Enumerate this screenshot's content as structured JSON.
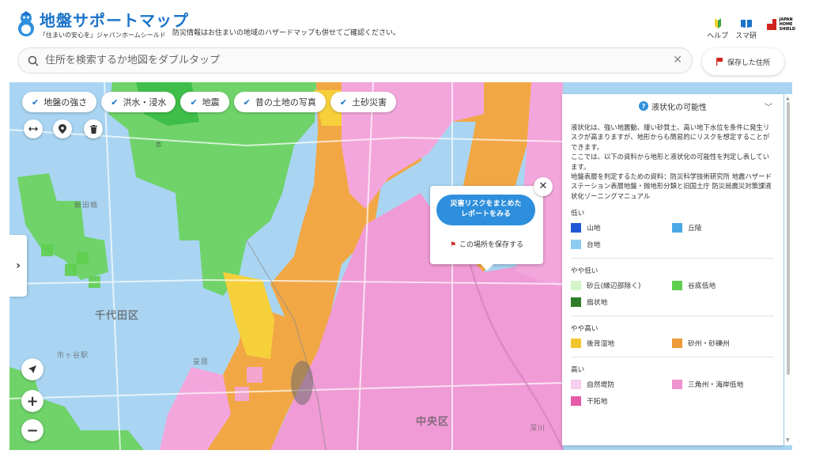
{
  "header": {
    "app_title": "地盤サポートマップ",
    "subtitle": "「住まいの安心を」ジャパンホームシールド",
    "tagline": "防災情報はお住まいの地域のハザードマップも併せてご確認ください。",
    "help_label": "ヘルプ",
    "app_label": "スマ研",
    "brand_logo_text": "JAPAN HOME SHIELD"
  },
  "search": {
    "placeholder": "住所を検索するか地図をダブルタップ",
    "clear_icon": "close-icon"
  },
  "saved_button": {
    "label": "保存した住所"
  },
  "layer_chips": [
    {
      "label": "地盤の強さ",
      "checked": true
    },
    {
      "label": "洪水・浸水",
      "checked": true
    },
    {
      "label": "地震",
      "checked": true
    },
    {
      "label": "昔の土地の写真",
      "checked": true
    },
    {
      "label": "土砂災害",
      "checked": true
    }
  ],
  "map_labels": {
    "chiyoda": "千代田区",
    "chuo": "中央区",
    "hon": "本",
    "kokyo": "皇居",
    "iidabashi": "飯田橋",
    "ichigaya": "市ヶ谷駅",
    "fukagawa": "深川"
  },
  "popup": {
    "report_button": "災害リスクをまとめた\nレポートをみる",
    "save_label": "この場所を保存する"
  },
  "legend": {
    "title": "液状化の可能性",
    "description": "液状化は、強い地震動、緩い砂質土、高い地下水位を条件に発生リスクが高まりますが、地形からも簡易的にリスクを想定することができます。\nここでは、以下の資料から地形と液状化の可能性を判定し表しています。\n地盤表層を判定するための資料：防災科学技術研究所 地震ハザードステーション表層地盤・微地形分類と旧国土庁 防災局震災対策課液状化ゾーニングマニュアル",
    "groups": [
      {
        "title": "低い",
        "items": [
          {
            "label": "山地",
            "color": "#1f57d6"
          },
          {
            "label": "丘陵",
            "color": "#48a9e6"
          },
          {
            "label": "台地",
            "color": "#8ccbf2"
          }
        ]
      },
      {
        "title": "やや低い",
        "items": [
          {
            "label": "砂丘(縁辺部除く)",
            "color": "#d3f5c9"
          },
          {
            "label": "谷底低地",
            "color": "#5fcf4f"
          },
          {
            "label": "扇状地",
            "color": "#2e7d2a"
          }
        ]
      },
      {
        "title": "やや高い",
        "items": [
          {
            "label": "後背湿地",
            "color": "#f2c62f"
          },
          {
            "label": "砂州・砂礫州",
            "color": "#ef9a3a"
          }
        ]
      },
      {
        "title": "高い",
        "items": [
          {
            "label": "自然堤防",
            "color": "#f7cdf0"
          },
          {
            "label": "三角州・海岸低地",
            "color": "#ef93d0"
          },
          {
            "label": "干拓地",
            "color": "#e65aa8"
          }
        ]
      }
    ]
  },
  "colors": {
    "brand_blue": "#1a73c9",
    "button_blue": "#2d8fdd",
    "flag_red": "#d0251e"
  }
}
